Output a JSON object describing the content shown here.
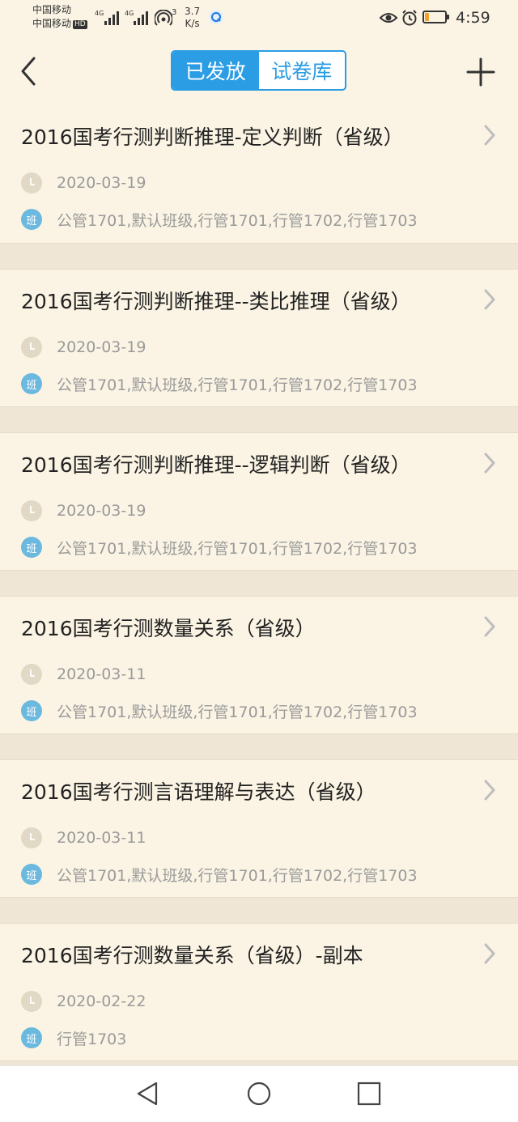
{
  "status_bar": {
    "carrier_1": "中国移动",
    "carrier_2": "中国移动",
    "hd_badge": "HD",
    "net_1": "4G",
    "net_2": "4G",
    "hotspot_count": "3",
    "speed_value": "3.7",
    "speed_unit": "K/s",
    "time": "4:59",
    "battery_level": 0.2,
    "icons": [
      "signal-icon",
      "hotspot-icon",
      "eye-icon",
      "alarm-icon",
      "battery-icon"
    ]
  },
  "header": {
    "tabs": [
      {
        "label": "已发放",
        "active": true
      },
      {
        "label": "试卷库",
        "active": false
      }
    ],
    "accent_color": "#2a9de4"
  },
  "papers": [
    {
      "title": "2016国考行测判断推理-定义判断（省级）",
      "date": "2020-03-19",
      "badge": "班",
      "classes": "公管1701,默认班级,行管1701,行管1702,行管1703"
    },
    {
      "title": "2016国考行测判断推理--类比推理（省级）",
      "date": "2020-03-19",
      "badge": "班",
      "classes": "公管1701,默认班级,行管1701,行管1702,行管1703"
    },
    {
      "title": "2016国考行测判断推理--逻辑判断（省级）",
      "date": "2020-03-19",
      "badge": "班",
      "classes": "公管1701,默认班级,行管1701,行管1702,行管1703"
    },
    {
      "title": "2016国考行测数量关系（省级）",
      "date": "2020-03-11",
      "badge": "班",
      "classes": "公管1701,默认班级,行管1701,行管1702,行管1703"
    },
    {
      "title": "2016国考行测言语理解与表达（省级）",
      "date": "2020-03-11",
      "badge": "班",
      "classes": "公管1701,默认班级,行管1701,行管1702,行管1703"
    },
    {
      "title": "2016国考行测数量关系（省级）-副本",
      "date": "2020-02-22",
      "badge": "班",
      "classes": "行管1703"
    }
  ]
}
